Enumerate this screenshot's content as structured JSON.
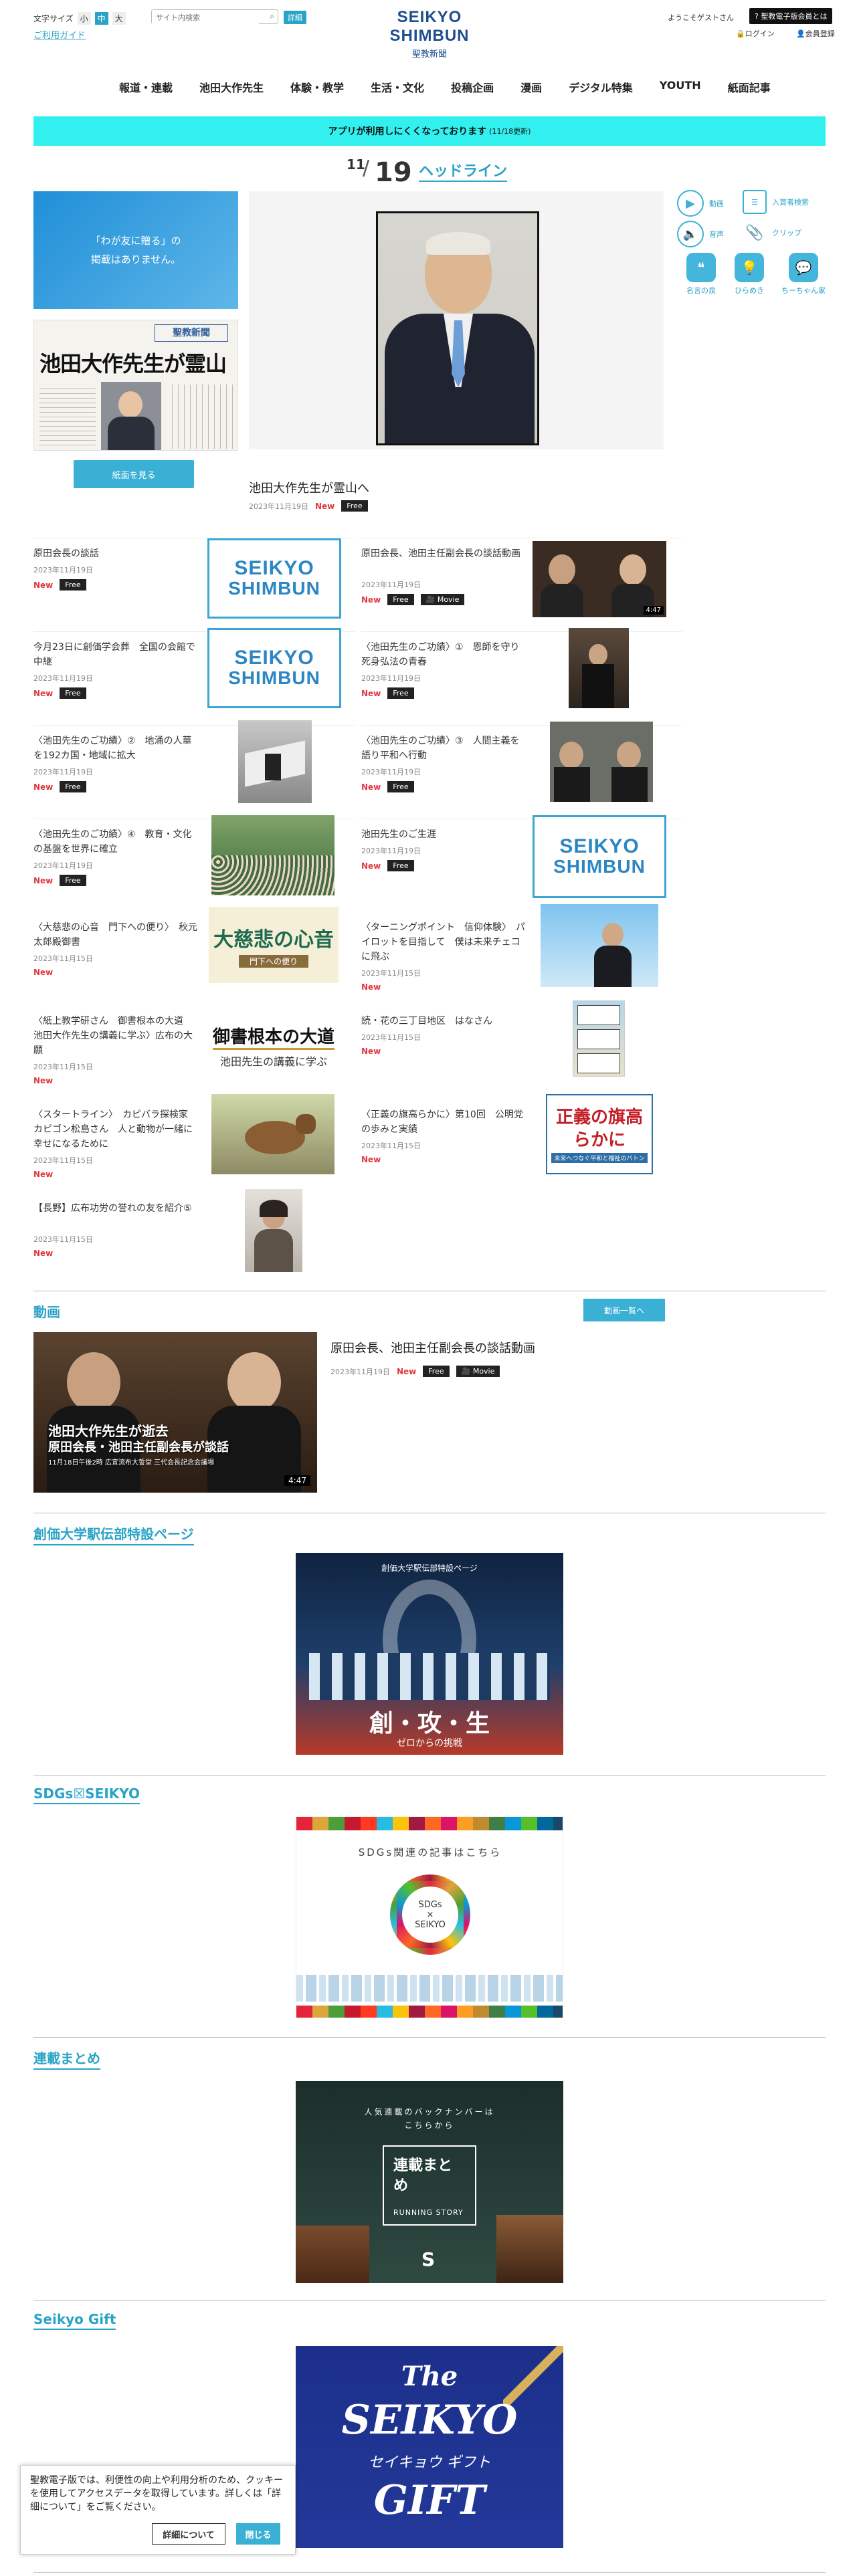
{
  "header": {
    "font_size_label": "文字サイズ",
    "font_sizes": [
      "小",
      "中",
      "大"
    ],
    "search_placeholder": "サイト内検索",
    "search_button": "詳細",
    "usage_guide": "ご利用ガイド",
    "logo_text": "SEIKYO SHIMBUN",
    "logo_sub": "聖教新聞",
    "welcome": "ようこそゲストさん",
    "about_button": "聖教電子版会員とは",
    "login": "ログイン",
    "register": "会員登録"
  },
  "nav": [
    "報道・連載",
    "池田大作先生",
    "体験・教学",
    "生活・文化",
    "投稿企画",
    "漫画",
    "デジタル特集",
    "YOUTH",
    "紙面記事"
  ],
  "alert": {
    "text": "アプリが利用しにくくなっております",
    "update": "(11/18更新)"
  },
  "headline": {
    "month": "11",
    "day": "19",
    "label": "ヘッドライン"
  },
  "left_panel": {
    "notice": "「わが友に贈る」の\n掲載はありません。",
    "paper_button": "紙面を見る",
    "paper_masthead": "聖教新聞",
    "paper_headline": "池田大作先生が霊山へ"
  },
  "main_article": {
    "title": "池田大作先生が霊山へ",
    "date": "2023年11月19日",
    "new": "New",
    "free": "Free"
  },
  "side_tools": [
    {
      "label": "動画",
      "icon": "play-icon"
    },
    {
      "label": "入賞者検索",
      "icon": "list-icon"
    },
    {
      "label": "音声",
      "icon": "speaker-icon"
    },
    {
      "label": "クリップ",
      "icon": "clip-icon"
    },
    {
      "label": "名言の泉",
      "icon": "quote-icon"
    },
    {
      "label": "ひらめき",
      "icon": "bulb-icon"
    },
    {
      "label": "ちーちゃん家",
      "icon": "chat-icon"
    }
  ],
  "articles": [
    {
      "title": "原田会長の談話",
      "date": "2023年11月19日",
      "new": "New",
      "free": "Free"
    },
    {
      "title": "原田会長、池田主任副会長の談話動画",
      "date": "2023年11月19日",
      "new": "New",
      "free": "Free",
      "movie": "Movie",
      "duration": "4:47"
    },
    {
      "title": "今月23日に創価学会葬　全国の会館で中継",
      "date": "2023年11月19日",
      "new": "New",
      "free": "Free"
    },
    {
      "title": "〈池田先生のご功績〉①　恩師を守り死身弘法の青春",
      "date": "2023年11月19日",
      "new": "New",
      "free": "Free"
    },
    {
      "title": "〈池田先生のご功績〉②　地涌の人華を192カ国・地域に拡大",
      "date": "2023年11月19日",
      "new": "New",
      "free": "Free"
    },
    {
      "title": "〈池田先生のご功績〉③　人間主義を語り平和へ行動",
      "date": "2023年11月19日",
      "new": "New",
      "free": "Free"
    },
    {
      "title": "〈池田先生のご功績〉④　教育・文化の基盤を世界に確立",
      "date": "2023年11月19日",
      "new": "New",
      "free": "Free"
    },
    {
      "title": "池田先生のご生涯",
      "date": "2023年11月19日",
      "new": "New",
      "free": "Free"
    },
    {
      "title": "〈大慈悲の心音　門下への便り〉　秋元太郎殿御書",
      "date": "2023年11月15日",
      "new": "New"
    },
    {
      "title": "〈ターニングポイント　信仰体験〉　パイロットを目指して　僕は未来チェコに飛ぶ",
      "date": "2023年11月15日",
      "new": "New"
    },
    {
      "title": "〈紙上教学研さん　御書根本の大道　池田大作先生の講義に学ぶ〉広布の大願",
      "date": "2023年11月15日",
      "new": "New"
    },
    {
      "title": "続・花の三丁目地区　はなさん",
      "date": "2023年11月15日",
      "new": "New"
    },
    {
      "title": "〈スタートライン〉　カピバラ探検家　カピゴン松島さん　人と動物が一緒に幸せになるために",
      "date": "2023年11月15日",
      "new": "New"
    },
    {
      "title": "〈正義の旗高らかに〉第10回　公明党の歩みと実績",
      "date": "2023年11月15日",
      "new": "New"
    },
    {
      "title": "【長野】広布功労の誉れの友を紹介⑤",
      "date": "2023年11月15日",
      "new": "New"
    }
  ],
  "thumb_text": {
    "logo_line1": "SEIKYO",
    "logo_line2": "SHIMBUN",
    "jihi_big": "大慈悲の心音",
    "jihi_sub": "門下への便り",
    "gosho_big": "御書根本の大道",
    "gosho_sub": "池田先生の講義に学ぶ",
    "seigi": "正義の旗高らかに",
    "seigi_sub": "未来へつなぐ平和と福祉のバトン"
  },
  "video_section": {
    "heading": "動画",
    "more_button": "動画一覧へ",
    "title": "原田会長、池田主任副会長の談話動画",
    "date": "2023年11月19日",
    "new": "New",
    "free": "Free",
    "movie": "Movie",
    "duration": "4:47",
    "overlay_line1": "池田大作先生が逝去",
    "overlay_line2": "原田会長・池田主任副会長が談話",
    "overlay_line3": "11月18日午後2時  広宣流布大誓堂  三代会長記念会議場"
  },
  "ekiden": {
    "heading": "創価大学駅伝部特設ページ",
    "banner_top": "創価大学駅伝部特設ページ",
    "banner_title": "創・攻・生",
    "banner_sub": "ゼロからの挑戦"
  },
  "sdgs": {
    "heading": "SDGs☒SEIKYO",
    "banner_text": "SDGs関連の記事はこちら",
    "badge_line1": "SDGs",
    "badge_line2": "×",
    "badge_line3": "SEIKYO"
  },
  "rensai": {
    "heading": "連載まとめ",
    "banner_top": "人気連載のバックナンバーは\nこちらから",
    "banner_title": "連載まとめ",
    "banner_en": "RUNNING STORY"
  },
  "gift": {
    "heading": "Seikyo Gift",
    "line1": "The",
    "line2": "SEIKYO",
    "line3": "セイキョウ ギフト",
    "line4": "GIFT"
  },
  "cookie": {
    "text": "聖教電子版では、利便性の向上や利用分析のため、クッキーを使用してアクセスデータを取得しています。詳しくは「詳細について」をご覧ください。",
    "details": "詳細について",
    "close": "閉じる"
  }
}
